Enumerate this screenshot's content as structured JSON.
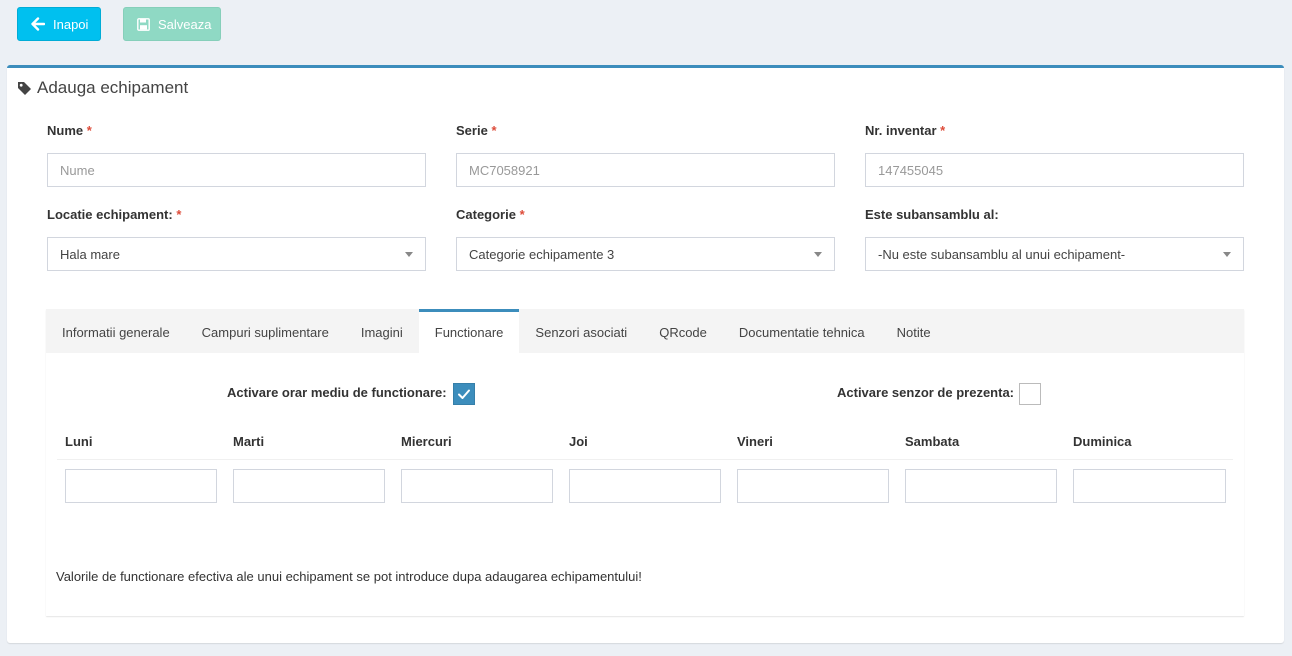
{
  "toolbar": {
    "back_label": "Inapoi",
    "save_label": "Salveaza"
  },
  "box": {
    "title": "Adauga echipament"
  },
  "form": {
    "nume": {
      "label": "Nume",
      "placeholder": "Nume"
    },
    "serie": {
      "label": "Serie",
      "placeholder": "MC7058921"
    },
    "inventar": {
      "label": "Nr. inventar",
      "placeholder": "147455045"
    },
    "locatie": {
      "label": "Locatie echipament:",
      "value": "Hala mare"
    },
    "categorie": {
      "label": "Categorie",
      "value": "Categorie echipamente 3"
    },
    "subansamblu": {
      "label": "Este subansamblu al:",
      "value": "-Nu este subansamblu al unui echipament-"
    }
  },
  "tabs": [
    {
      "label": "Informatii generale"
    },
    {
      "label": "Campuri suplimentare"
    },
    {
      "label": "Imagini"
    },
    {
      "label": "Functionare"
    },
    {
      "label": "Senzori asociati"
    },
    {
      "label": "QRcode"
    },
    {
      "label": "Documentatie tehnica"
    },
    {
      "label": "Notite"
    }
  ],
  "active_tab": "Functionare",
  "functionare": {
    "orar_label": "Activare orar mediu de functionare:",
    "orar_checked": true,
    "senzor_label": "Activare senzor de prezenta:",
    "senzor_checked": false,
    "days": [
      "Luni",
      "Marti",
      "Miercuri",
      "Joi",
      "Vineri",
      "Sambata",
      "Duminica"
    ],
    "note": "Valorile de functionare efectiva ale unui echipament se pot introduce dupa adaugarea echipamentului!"
  },
  "colors": {
    "accent": "#3c8dbc",
    "info": "#00c0ef",
    "success_disabled": "#8fd9c4",
    "required": "#dd4b39"
  }
}
